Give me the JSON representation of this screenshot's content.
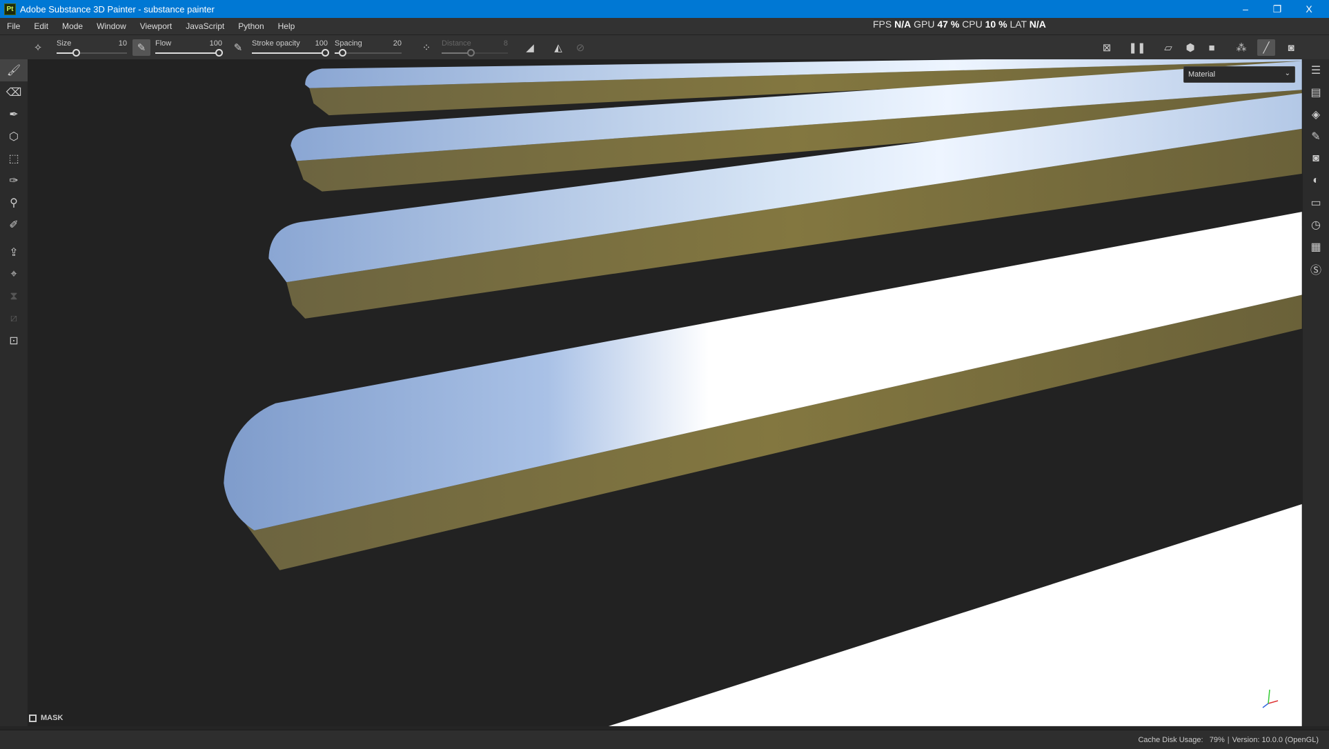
{
  "window": {
    "title": "Adobe Substance 3D Painter - substance painter",
    "logo": "Pt",
    "minimize": "–",
    "restore": "❐",
    "close": "X"
  },
  "menu": [
    "File",
    "Edit",
    "Mode",
    "Window",
    "Viewport",
    "JavaScript",
    "Python",
    "Help"
  ],
  "stats": {
    "fps_label": "FPS",
    "fps": "N/A",
    "gpu_label": "GPU",
    "gpu": "47 %",
    "cpu_label": "CPU",
    "cpu": "10 %",
    "lat_label": "LAT",
    "lat": "N/A"
  },
  "toolbar": {
    "size": {
      "label": "Size",
      "value": "10",
      "fraction": 0.1
    },
    "flow": {
      "label": "Flow",
      "value": "100",
      "fraction": 1.0
    },
    "stroke_opacity": {
      "label": "Stroke opacity",
      "value": "100",
      "fraction": 1.0
    },
    "spacing": {
      "label": "Spacing",
      "value": "20",
      "fraction": 0.02
    },
    "distance": {
      "label": "Distance",
      "value": "8",
      "fraction": 0.3
    }
  },
  "viewport": {
    "channel": "Material",
    "mask_label": "MASK"
  },
  "status": {
    "cache": "Cache Disk Usage:   79%",
    "separator": "|",
    "version": "Version: 10.0.0 (OpenGL)"
  },
  "colors": {
    "titlebar": "#0078d4",
    "panel": "#2b2b2b",
    "viewport": "#222222",
    "metal_light": "#ffffff",
    "metal_blue": "#8ea8d2",
    "side_olive": "#7a7040"
  }
}
